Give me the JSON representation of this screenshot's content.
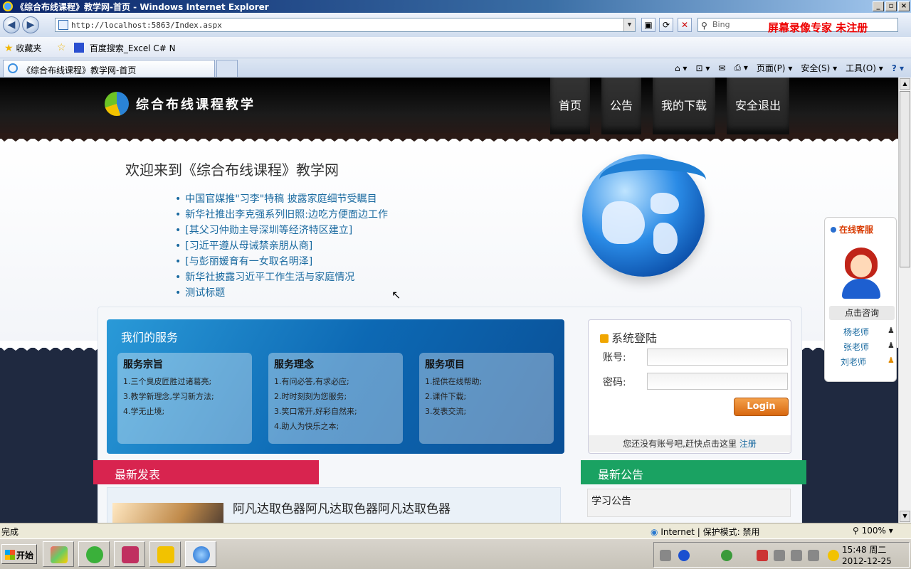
{
  "window": {
    "title": "《综合布线课程》教学网-首页 - Windows Internet Explorer",
    "url": "http://localhost:5863/Index.aspx",
    "search_placeholder": "Bing",
    "recorder_banner": "屏幕录像专家  未注册"
  },
  "favorites_bar": {
    "favorites_label": "收藏夹",
    "link": "百度搜索_Excel C# N"
  },
  "tabs": [
    {
      "label": "《综合布线课程》教学网-首页"
    }
  ],
  "command_bar": {
    "page": "页面(P)",
    "safety": "安全(S)",
    "tools": "工具(O)"
  },
  "site": {
    "logo_text": "综合布线课程教学",
    "nav": [
      "首页",
      "公告",
      "我的下载",
      "安全退出"
    ],
    "welcome": "欢迎来到《综合布线课程》教学网",
    "news": [
      "中国官媒推\"习李\"特稿 披露家庭细节受瞩目",
      "新华社推出李克强系列旧照:边吃方便面边工作",
      "[其父习仲勋主导深圳等经济特区建立]",
      "[习近平遵从母诫禁亲朋从商]",
      "[与彭丽媛育有一女取名明泽]",
      "新华社披露习近平工作生活与家庭情况",
      "测试标题"
    ],
    "services": {
      "title": "我们的服务",
      "cards": [
        {
          "title": "服务宗旨",
          "lines": [
            "1.三个臭皮匠胜过诸葛亮;",
            "3.教学新理念,学习新方法;",
            "4.学无止境;"
          ]
        },
        {
          "title": "服务理念",
          "lines": [
            "1.有问必答,有求必应;",
            "2.时时刻刻为您服务;",
            "3.笑口常开,好彩自然来;",
            "4.助人为快乐之本;"
          ]
        },
        {
          "title": "服务项目",
          "lines": [
            "1.提供在线帮助;",
            "2.课件下载;",
            "3.发表交流;"
          ]
        }
      ]
    },
    "login": {
      "title": "系统登陆",
      "account_label": "账号:",
      "password_label": "密码:",
      "account_value": "",
      "password_value": "",
      "button": "Login",
      "footer_text": "您还没有账号吧,赶快点击这里",
      "register_link": "注册"
    },
    "latest_posts": {
      "header": "最新发表",
      "first_title": "阿凡达取色器阿凡达取色器阿凡达取色器"
    },
    "notices": {
      "header": "最新公告",
      "first_item": "学习公告"
    },
    "online_service": {
      "title": "在线客服",
      "consult": "点击咨询",
      "teachers": [
        "杨老师",
        "张老师",
        "刘老师"
      ]
    }
  },
  "status_bar": {
    "text": "完成",
    "zone": "Internet | 保护模式: 禁用",
    "zoom": "100%"
  },
  "taskbar": {
    "start": "开始",
    "time": "15:48 周二",
    "date": "2012-12-25"
  },
  "colors": {
    "latest_posts_bar": "#d8244f",
    "notices_bar": "#1aa262",
    "link": "#1a6aa0",
    "login_button": "#e07a20"
  }
}
